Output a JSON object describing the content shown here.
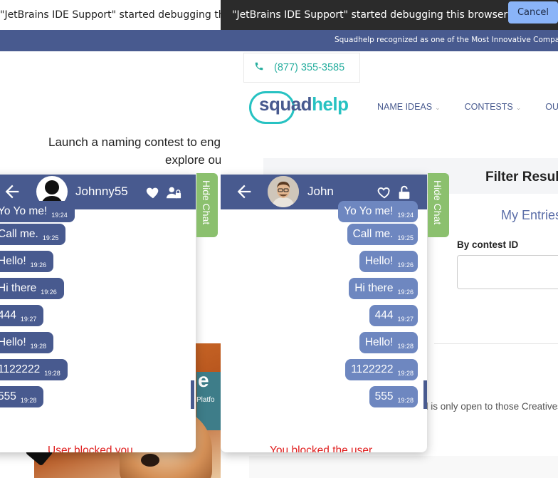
{
  "left_pane": {
    "debug_message": "\"JetBrains IDE Support\" started debugging this browser",
    "hero_line1": "Launch a naming contest to engage hundreds of naming experts",
    "hero_line2": "explore our platform",
    "chat": {
      "user_name": "Johnny55",
      "hide_chat_label": "Hide Chat",
      "status_text": "User blocked you",
      "messages": [
        {
          "text": "Yo Yo me!",
          "time": "19:24"
        },
        {
          "text": "Call me.",
          "time": "19:25"
        },
        {
          "text": "Hello!",
          "time": "19:26"
        },
        {
          "text": "Hi there",
          "time": "19:26"
        },
        {
          "text": "444",
          "time": "19:27"
        },
        {
          "text": "Hello!",
          "time": "19:28"
        },
        {
          "text": "1122222",
          "time": "19:28"
        },
        {
          "text": "555",
          "time": "19:28"
        }
      ],
      "icons": [
        "back-arrow-icon",
        "heart-filled-icon",
        "user-blocked-icon"
      ]
    },
    "photo_text_e": "e",
    "photo_text_platform": "Platfo"
  },
  "right_pane": {
    "debug_message": "\"JetBrains IDE Support\" started debugging this browser",
    "cancel_label": "Cancel",
    "banner_text": "Squadhelp recognized as one of the Most Innovative Companies",
    "phone": "(877) 355-3585",
    "logo": {
      "part1": "squad",
      "part2": "help"
    },
    "nav": [
      {
        "label": "NAME IDEAS"
      },
      {
        "label": "CONTESTS"
      },
      {
        "label": "OUR WORK"
      }
    ],
    "filter_title": "Filter Results",
    "my_entries": "My Entries",
    "contest_id_label": "By contest ID",
    "open_text": "d is only open to those Creatives",
    "chat": {
      "user_name": "John",
      "hide_chat_label": "Hide Chat",
      "status_text": "You blocked the user",
      "messages": [
        {
          "text": "Yo Yo me!",
          "time": "19:24"
        },
        {
          "text": "Call me.",
          "time": "19:25"
        },
        {
          "text": "Hello!",
          "time": "19:26"
        },
        {
          "text": "Hi there",
          "time": "19:26"
        },
        {
          "text": "444",
          "time": "19:27"
        },
        {
          "text": "Hello!",
          "time": "19:28"
        },
        {
          "text": "1122222",
          "time": "19:28"
        },
        {
          "text": "555",
          "time": "19:28"
        }
      ],
      "icons": [
        "back-arrow-icon",
        "heart-outline-icon",
        "unlock-icon"
      ]
    }
  },
  "colors": {
    "navy": "#485a8f",
    "bubble_light": "#6e87c0",
    "teal": "#27c2c2",
    "hide_chat_green": "#8bc06e",
    "cancel_button": "#8ab4f8",
    "status_red": "#e02020"
  }
}
